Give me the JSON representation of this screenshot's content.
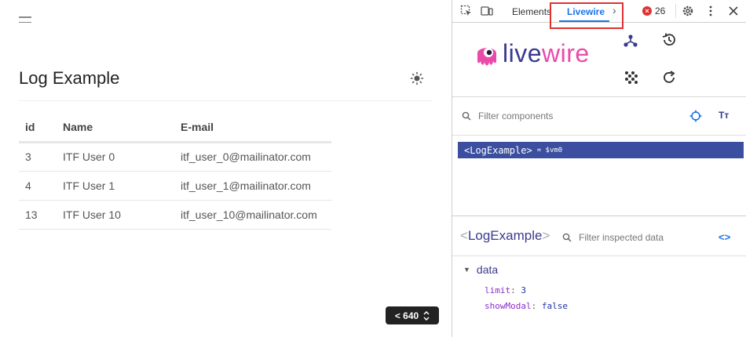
{
  "app": {
    "title": "Log Example",
    "table": {
      "headers": [
        "id",
        "Name",
        "E-mail"
      ],
      "rows": [
        {
          "id": "3",
          "name": "ITF User 0",
          "email": "itf_user_0@mailinator.com"
        },
        {
          "id": "4",
          "name": "ITF User 1",
          "email": "itf_user_1@mailinator.com"
        },
        {
          "id": "13",
          "name": "ITF User 10",
          "email": "itf_user_10@mailinator.com"
        }
      ]
    },
    "breakpoint_badge": "< 640"
  },
  "devtools": {
    "tabs": {
      "elements": "Elements",
      "livewire": "Livewire",
      "more": "›"
    },
    "error_count": "26",
    "logo": {
      "live": "live",
      "wire": "wire"
    },
    "filter_components_placeholder": "Filter components",
    "text_toggle": "Tт",
    "component": {
      "name": "<LogExample>",
      "ref": "= $vm0"
    },
    "inspected": {
      "open": "<",
      "name": "LogExample",
      "close": ">"
    },
    "filter_inspected_placeholder": "Filter inspected data",
    "code_toggle": "<>",
    "data_section": {
      "label": "data",
      "props": [
        {
          "key": "limit",
          "value": "3"
        },
        {
          "key": "showModal",
          "value": "false"
        }
      ]
    },
    "colors": {
      "accent": "#1a73e8",
      "component_row": "#3b4e9f",
      "livewire_pink": "#ea4aaa",
      "livewire_navy": "#3a3a8f",
      "error": "#e03131"
    }
  }
}
